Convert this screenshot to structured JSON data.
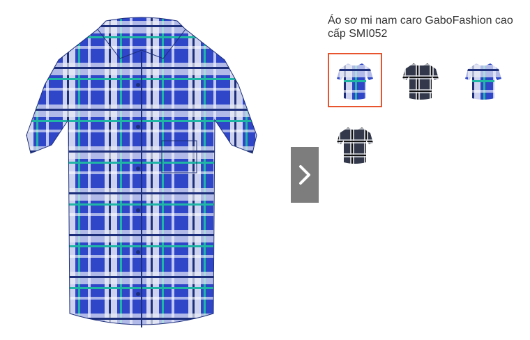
{
  "product": {
    "title": "Áo sơ mi nam caro GaboFashion cao cấp SMI052",
    "main_image": {
      "variant": "blue"
    }
  },
  "gallery": {
    "next_button_icon": "chevron-right-icon",
    "thumbnails": [
      {
        "variant": "blue",
        "selected": true
      },
      {
        "variant": "dark",
        "selected": false
      },
      {
        "variant": "blue",
        "selected": false
      },
      {
        "variant": "dark",
        "selected": false
      }
    ]
  },
  "colors": {
    "selected_border": "#e8542e",
    "next_button_bg": "#7d7d7d",
    "shirt_blue": "#2f46c8",
    "shirt_dark": "#33394a"
  }
}
